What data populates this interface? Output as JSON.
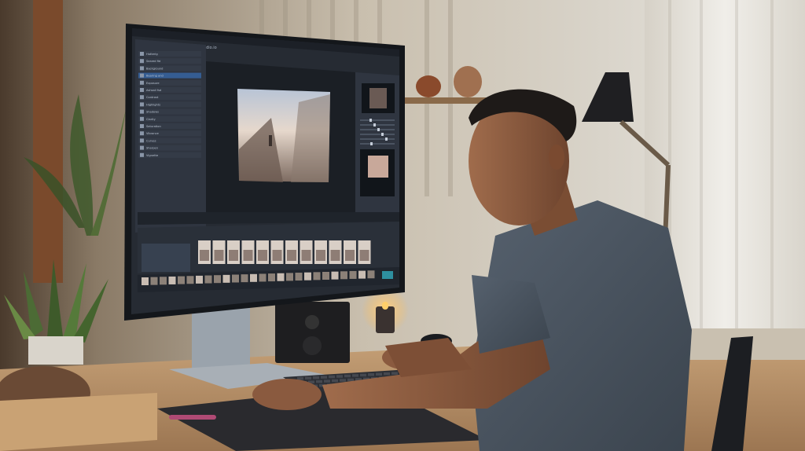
{
  "scene": {
    "description_colors": {
      "wall_left": "#5a4a3a",
      "wall_mid": "#cfc6b4",
      "window_light": "#e8e6e0",
      "desk_wood": "#b89368",
      "monitor_frame": "#1d2026",
      "editor_bg": "#262b33",
      "editor_panel": "#2f3540",
      "accent_blue": "#3b78c9",
      "shirt": "#4a5460",
      "skin": "#8a5a3f"
    }
  },
  "monitor": {
    "app_title": "Kodio.io",
    "layers": [
      "Hatterig",
      "Seared fid",
      "Background",
      "Bearing and",
      "Exposure",
      "Ashsail fsd",
      "Contrast",
      "Highlights",
      "Shadows",
      "Clarity",
      "Saturation",
      "Vibrance",
      "Curves",
      "Sharpen",
      "Vignette"
    ],
    "filmstrip_count": 12,
    "timeline_count": 26
  },
  "icons": {
    "plant": "snake-plant-icon",
    "lamp": "desk-lamp-icon",
    "candle": "candle-icon"
  }
}
